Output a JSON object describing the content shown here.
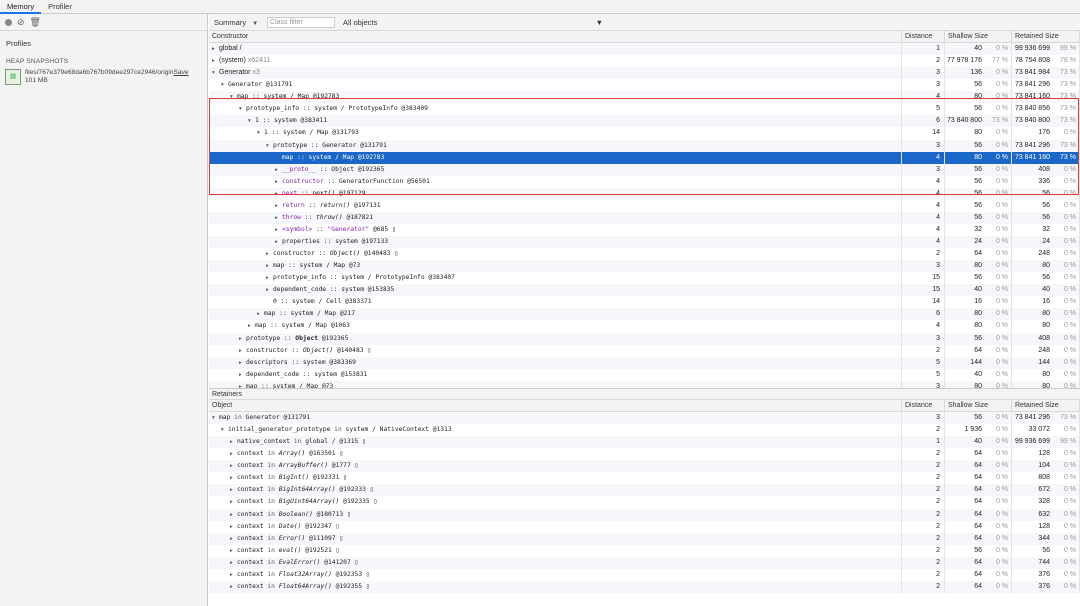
{
  "tabs": [
    {
      "label": "Memory",
      "selected": true
    },
    {
      "label": "Profiler",
      "selected": false
    }
  ],
  "sidebar": {
    "profiles_label": "Profiles",
    "heap_label": "HEAP SNAPSHOTS",
    "snapshot": {
      "name_a": "files/767e379e68da6b767b09dee297ce2946/origin",
      "name_b": "Save",
      "size": "101 MB"
    }
  },
  "toolbar": {
    "view": "Summary",
    "class_filter_placeholder": "Class filter",
    "objects": "All objects"
  },
  "columns": {
    "constructor": "Constructor",
    "object": "Object",
    "distance": "Distance",
    "shallow": "Shallow Size",
    "retained": "Retained Size"
  },
  "rows": [
    {
      "ind": 0,
      "tri": "▸",
      "seg": [
        {
          "t": "global /"
        }
      ],
      "d": "1",
      "s": "40",
      "sp": "0 %",
      "r": "99 936 699",
      "rp": "99 %"
    },
    {
      "ind": 0,
      "tri": "▸",
      "seg": [
        {
          "t": "(system)"
        },
        {
          "t": "  x62411",
          "c": "g"
        }
      ],
      "d": "2",
      "s": "77 978 176",
      "sp": "77 %",
      "r": "78 754 808",
      "rp": "78 %"
    },
    {
      "ind": 0,
      "tri": "▾",
      "seg": [
        {
          "t": "Generator"
        },
        {
          "t": "  x3",
          "c": "g"
        }
      ],
      "d": "3",
      "s": "136",
      "sp": "0 %",
      "r": "73 841 984",
      "rp": "73 %"
    },
    {
      "ind": 1,
      "tri": "▾",
      "seg": [
        {
          "t": "Generator @131791",
          "c": "m"
        }
      ],
      "d": "3",
      "s": "56",
      "sp": "0 %",
      "r": "73 841 296",
      "rp": "73 %"
    },
    {
      "ind": 2,
      "tri": "▾",
      "seg": [
        {
          "t": "map :: system / Map @192783",
          "c": "m"
        }
      ],
      "d": "4",
      "s": "80",
      "sp": "0 %",
      "r": "73 841 160",
      "rp": "73 %"
    },
    {
      "ind": 3,
      "tri": "▾",
      "seg": [
        {
          "t": "prototype_info :: system / PrototypeInfo @383409",
          "c": "m"
        }
      ],
      "d": "5",
      "s": "56",
      "sp": "0 %",
      "r": "73 840 856",
      "rp": "73 %"
    },
    {
      "ind": 4,
      "tri": "▾",
      "seg": [
        {
          "t": "1 :: system @383411",
          "c": "m"
        }
      ],
      "d": "6",
      "s": "73 840 800",
      "sp": "73 %",
      "r": "73 840 800",
      "rp": "73 %"
    },
    {
      "ind": 5,
      "tri": "▾",
      "seg": [
        {
          "t": "1 :: system / Map @131793",
          "c": "m"
        }
      ],
      "d": "14",
      "s": "80",
      "sp": "0 %",
      "r": "176",
      "rp": "0 %"
    },
    {
      "ind": 6,
      "tri": "▾",
      "seg": [
        {
          "t": "prototype :: Generator @131791",
          "c": "m"
        }
      ],
      "d": "3",
      "s": "56",
      "sp": "0 %",
      "r": "73 841 296",
      "rp": "73 %"
    },
    {
      "ind": 7,
      "tri": "",
      "sel": true,
      "seg": [
        {
          "t": "map :: system / Map @192783",
          "c": "m"
        }
      ],
      "d": "4",
      "s": "80",
      "sp": "0 %",
      "r": "73 841 160",
      "rp": "73 %"
    },
    {
      "ind": 7,
      "tri": "▸",
      "seg": [
        {
          "t": "__proto__",
          "c": "m purple"
        },
        {
          "t": " :: Object @192365",
          "c": "m"
        }
      ],
      "d": "3",
      "s": "56",
      "sp": "0 %",
      "r": "408",
      "rp": "0 %"
    },
    {
      "ind": 7,
      "tri": "▸",
      "seg": [
        {
          "t": "constructor",
          "c": "m purple"
        },
        {
          "t": " :: GeneratorFunction @56501",
          "c": "m"
        }
      ],
      "d": "4",
      "s": "56",
      "sp": "0 %",
      "r": "336",
      "rp": "0 %"
    },
    {
      "ind": 7,
      "tri": "▸",
      "seg": [
        {
          "t": "next",
          "c": "m purple"
        },
        {
          "t": " :: ",
          "c": "m"
        },
        {
          "t": "next()",
          "c": "m it"
        },
        {
          "t": " @197129",
          "c": "m"
        }
      ],
      "d": "4",
      "s": "56",
      "sp": "0 %",
      "r": "56",
      "rp": "0 %"
    },
    {
      "ind": 7,
      "tri": "▸",
      "seg": [
        {
          "t": "return",
          "c": "m purple"
        },
        {
          "t": " :: ",
          "c": "m"
        },
        {
          "t": "return()",
          "c": "m it"
        },
        {
          "t": " @197131",
          "c": "m"
        }
      ],
      "d": "4",
      "s": "56",
      "sp": "0 %",
      "r": "56",
      "rp": "0 %"
    },
    {
      "ind": 7,
      "tri": "▸",
      "seg": [
        {
          "t": "throw",
          "c": "m purple"
        },
        {
          "t": " :: ",
          "c": "m"
        },
        {
          "t": "throw()",
          "c": "m it"
        },
        {
          "t": " @187821",
          "c": "m"
        }
      ],
      "d": "4",
      "s": "56",
      "sp": "0 %",
      "r": "56",
      "rp": "0 %"
    },
    {
      "ind": 7,
      "tri": "▸",
      "seg": [
        {
          "t": "<symbol>",
          "c": "m purple"
        },
        {
          "t": " :: ",
          "c": "m"
        },
        {
          "t": "\"Generator\"",
          "c": "m purple"
        },
        {
          "t": " @685 ▯",
          "c": "m"
        }
      ],
      "d": "4",
      "s": "32",
      "sp": "0 %",
      "r": "32",
      "rp": "0 %"
    },
    {
      "ind": 7,
      "tri": "▸",
      "seg": [
        {
          "t": "properties :: system @197133",
          "c": "m"
        }
      ],
      "d": "4",
      "s": "24",
      "sp": "0 %",
      "r": "24",
      "rp": "0 %"
    },
    {
      "ind": 6,
      "tri": "▸",
      "seg": [
        {
          "t": "constructor :: ",
          "c": "m"
        },
        {
          "t": "Object()",
          "c": "m it"
        },
        {
          "t": " @140483 ▯",
          "c": "m"
        }
      ],
      "d": "2",
      "s": "64",
      "sp": "0 %",
      "r": "248",
      "rp": "0 %"
    },
    {
      "ind": 6,
      "tri": "▸",
      "seg": [
        {
          "t": "map :: system / Map @73",
          "c": "m"
        }
      ],
      "d": "3",
      "s": "80",
      "sp": "0 %",
      "r": "80",
      "rp": "0 %"
    },
    {
      "ind": 6,
      "tri": "▸",
      "seg": [
        {
          "t": "prototype_info :: system / PrototypeInfo @383407",
          "c": "m"
        }
      ],
      "d": "15",
      "s": "56",
      "sp": "0 %",
      "r": "56",
      "rp": "0 %"
    },
    {
      "ind": 6,
      "tri": "▸",
      "seg": [
        {
          "t": "dependent_code :: system @153835",
          "c": "m"
        }
      ],
      "d": "15",
      "s": "40",
      "sp": "0 %",
      "r": "40",
      "rp": "0 %"
    },
    {
      "ind": 6,
      "tri": "",
      "seg": [
        {
          "t": "0 :: system / Cell @383371",
          "c": "m"
        }
      ],
      "d": "14",
      "s": "16",
      "sp": "0 %",
      "r": "16",
      "rp": "0 %"
    },
    {
      "ind": 5,
      "tri": "▸",
      "seg": [
        {
          "t": "map :: system / Map @217",
          "c": "m"
        }
      ],
      "d": "6",
      "s": "80",
      "sp": "0 %",
      "r": "80",
      "rp": "0 %"
    },
    {
      "ind": 4,
      "tri": "▸",
      "seg": [
        {
          "t": "map :: system / Map @1063",
          "c": "m"
        }
      ],
      "d": "4",
      "s": "80",
      "sp": "0 %",
      "r": "80",
      "rp": "0 %"
    },
    {
      "ind": 3,
      "tri": "▸",
      "seg": [
        {
          "t": "prototype :: ",
          "c": "m"
        },
        {
          "t": "Object",
          "c": "m b"
        },
        {
          "t": " @192365",
          "c": "m"
        }
      ],
      "d": "3",
      "s": "56",
      "sp": "0 %",
      "r": "408",
      "rp": "0 %"
    },
    {
      "ind": 3,
      "tri": "▸",
      "seg": [
        {
          "t": "constructor :: ",
          "c": "m"
        },
        {
          "t": "Object()",
          "c": "m it"
        },
        {
          "t": " @140483 ▯",
          "c": "m"
        }
      ],
      "d": "2",
      "s": "64",
      "sp": "0 %",
      "r": "248",
      "rp": "0 %"
    },
    {
      "ind": 3,
      "tri": "▸",
      "seg": [
        {
          "t": "descriptors :: system @383369",
          "c": "m"
        }
      ],
      "d": "5",
      "s": "144",
      "sp": "0 %",
      "r": "144",
      "rp": "0 %"
    },
    {
      "ind": 3,
      "tri": "▸",
      "seg": [
        {
          "t": "dependent_code :: system @153831",
          "c": "m"
        }
      ],
      "d": "5",
      "s": "40",
      "sp": "0 %",
      "r": "80",
      "rp": "0 %"
    },
    {
      "ind": 3,
      "tri": "▸",
      "seg": [
        {
          "t": "map :: system / Map @73",
          "c": "m"
        }
      ],
      "d": "3",
      "s": "80",
      "sp": "0 %",
      "r": "80",
      "rp": "0 %"
    }
  ],
  "retainers_label": "Retainers",
  "retainers": [
    {
      "ind": 0,
      "tri": "▾",
      "seg": [
        {
          "t": "map",
          "c": "m"
        },
        {
          "t": " in ",
          "c": "m at"
        },
        {
          "t": "Generator @131791",
          "c": "m"
        }
      ],
      "d": "3",
      "s": "56",
      "sp": "0 %",
      "r": "73 841 296",
      "rp": "73 %"
    },
    {
      "ind": 1,
      "tri": "▾",
      "seg": [
        {
          "t": "initial_generator_prototype",
          "c": "m"
        },
        {
          "t": " in ",
          "c": "m at"
        },
        {
          "t": "system / NativeContext @1313",
          "c": "m"
        }
      ],
      "d": "2",
      "s": "1 936",
      "sp": "0 %",
      "r": "33 072",
      "rp": "0 %"
    },
    {
      "ind": 2,
      "tri": "▸",
      "seg": [
        {
          "t": "native_context",
          "c": "m"
        },
        {
          "t": " in ",
          "c": "m at"
        },
        {
          "t": "global /  @1315 ▯",
          "c": "m"
        }
      ],
      "d": "1",
      "s": "40",
      "sp": "0 %",
      "r": "99 936 699",
      "rp": "99 %"
    },
    {
      "ind": 2,
      "tri": "▸",
      "seg": [
        {
          "t": "context",
          "c": "m"
        },
        {
          "t": " in ",
          "c": "m at"
        },
        {
          "t": "Array()",
          "c": "m it"
        },
        {
          "t": " @163501 ▯",
          "c": "m"
        }
      ],
      "d": "2",
      "s": "64",
      "sp": "0 %",
      "r": "128",
      "rp": "0 %"
    },
    {
      "ind": 2,
      "tri": "▸",
      "seg": [
        {
          "t": "context",
          "c": "m"
        },
        {
          "t": " in ",
          "c": "m at"
        },
        {
          "t": "ArrayBuffer()",
          "c": "m it"
        },
        {
          "t": " @1777 ▯",
          "c": "m"
        }
      ],
      "d": "2",
      "s": "64",
      "sp": "0 %",
      "r": "104",
      "rp": "0 %"
    },
    {
      "ind": 2,
      "tri": "▸",
      "seg": [
        {
          "t": "context",
          "c": "m"
        },
        {
          "t": " in ",
          "c": "m at"
        },
        {
          "t": "BigInt()",
          "c": "m it"
        },
        {
          "t": " @192331 ▯",
          "c": "m"
        }
      ],
      "d": "2",
      "s": "64",
      "sp": "0 %",
      "r": "808",
      "rp": "0 %"
    },
    {
      "ind": 2,
      "tri": "▸",
      "seg": [
        {
          "t": "context",
          "c": "m"
        },
        {
          "t": " in ",
          "c": "m at"
        },
        {
          "t": "BigInt64Array()",
          "c": "m it"
        },
        {
          "t": " @192333 ▯",
          "c": "m"
        }
      ],
      "d": "2",
      "s": "64",
      "sp": "0 %",
      "r": "672",
      "rp": "0 %"
    },
    {
      "ind": 2,
      "tri": "▸",
      "seg": [
        {
          "t": "context",
          "c": "m"
        },
        {
          "t": " in ",
          "c": "m at"
        },
        {
          "t": "BigUint64Array()",
          "c": "m it"
        },
        {
          "t": " @192335 ▯",
          "c": "m"
        }
      ],
      "d": "2",
      "s": "64",
      "sp": "0 %",
      "r": "328",
      "rp": "0 %"
    },
    {
      "ind": 2,
      "tri": "▸",
      "seg": [
        {
          "t": "context",
          "c": "m"
        },
        {
          "t": " in ",
          "c": "m at"
        },
        {
          "t": "Boolean()",
          "c": "m it"
        },
        {
          "t": " @180713 ▯",
          "c": "m"
        }
      ],
      "d": "2",
      "s": "64",
      "sp": "0 %",
      "r": "632",
      "rp": "0 %"
    },
    {
      "ind": 2,
      "tri": "▸",
      "seg": [
        {
          "t": "context",
          "c": "m"
        },
        {
          "t": " in ",
          "c": "m at"
        },
        {
          "t": "Date()",
          "c": "m it"
        },
        {
          "t": " @192347 ▯",
          "c": "m"
        }
      ],
      "d": "2",
      "s": "64",
      "sp": "0 %",
      "r": "128",
      "rp": "0 %"
    },
    {
      "ind": 2,
      "tri": "▸",
      "seg": [
        {
          "t": "context",
          "c": "m"
        },
        {
          "t": " in ",
          "c": "m at"
        },
        {
          "t": "Error()",
          "c": "m it"
        },
        {
          "t": " @111097 ▯",
          "c": "m"
        }
      ],
      "d": "2",
      "s": "64",
      "sp": "0 %",
      "r": "344",
      "rp": "0 %"
    },
    {
      "ind": 2,
      "tri": "▸",
      "seg": [
        {
          "t": "context",
          "c": "m"
        },
        {
          "t": " in ",
          "c": "m at"
        },
        {
          "t": "eval()",
          "c": "m it"
        },
        {
          "t": " @192521 ▯",
          "c": "m"
        }
      ],
      "d": "2",
      "s": "56",
      "sp": "0 %",
      "r": "56",
      "rp": "0 %"
    },
    {
      "ind": 2,
      "tri": "▸",
      "seg": [
        {
          "t": "context",
          "c": "m"
        },
        {
          "t": " in ",
          "c": "m at"
        },
        {
          "t": "EvalError()",
          "c": "m it"
        },
        {
          "t": " @141207 ▯",
          "c": "m"
        }
      ],
      "d": "2",
      "s": "64",
      "sp": "0 %",
      "r": "744",
      "rp": "0 %"
    },
    {
      "ind": 2,
      "tri": "▸",
      "seg": [
        {
          "t": "context",
          "c": "m"
        },
        {
          "t": " in ",
          "c": "m at"
        },
        {
          "t": "Float32Array()",
          "c": "m it"
        },
        {
          "t": " @192353 ▯",
          "c": "m"
        }
      ],
      "d": "2",
      "s": "64",
      "sp": "0 %",
      "r": "376",
      "rp": "0 %"
    },
    {
      "ind": 2,
      "tri": "▸",
      "seg": [
        {
          "t": "context",
          "c": "m"
        },
        {
          "t": " in ",
          "c": "m at"
        },
        {
          "t": "Float64Array()",
          "c": "m it"
        },
        {
          "t": " @192355 ▯",
          "c": "m"
        }
      ],
      "d": "2",
      "s": "64",
      "sp": "0 %",
      "r": "376",
      "rp": "0 %"
    }
  ]
}
